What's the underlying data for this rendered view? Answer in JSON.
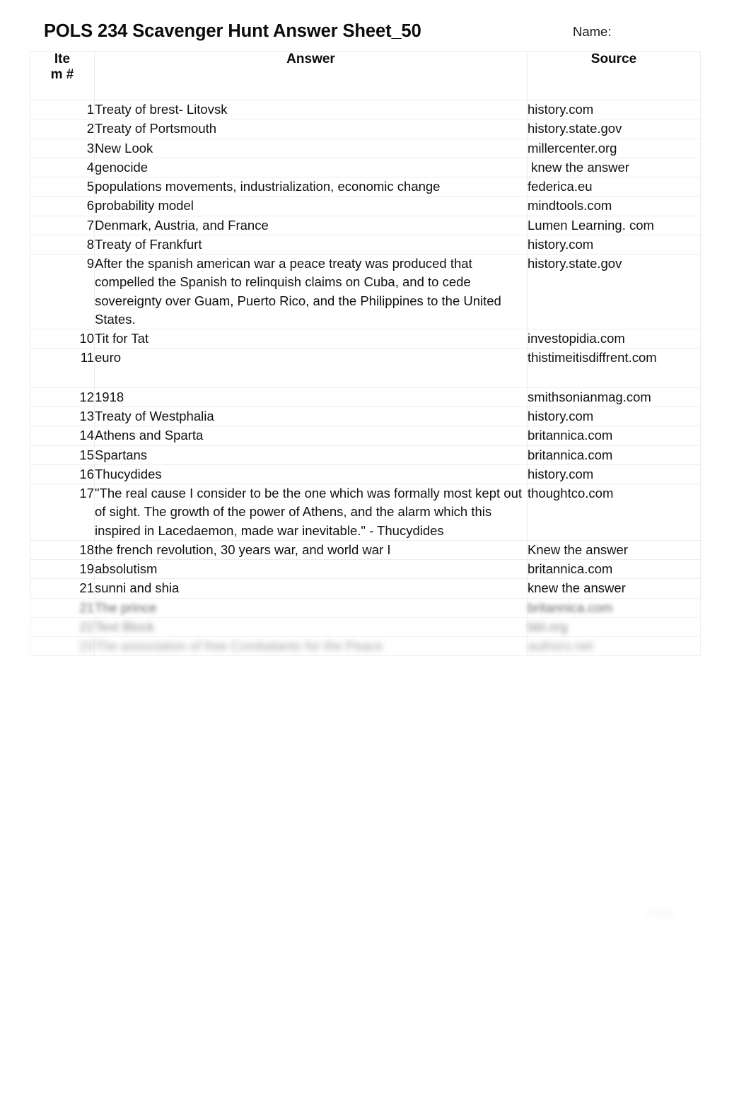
{
  "document": {
    "title": "POLS 234 Scavenger Hunt Answer Sheet_50",
    "name_label": "Name:",
    "page_number": "Page"
  },
  "table": {
    "columns": {
      "item": "Ite\nm #",
      "item_line1": "Ite",
      "item_line2": "m #",
      "answer": "Answer",
      "source": "Source"
    },
    "rows": [
      {
        "item": "1",
        "answer": "Treaty of brest- Litovsk",
        "source": "history.com"
      },
      {
        "item": "2",
        "answer": "Treaty of Portsmouth",
        "source": "history.state.gov"
      },
      {
        "item": "3",
        "answer": "New Look",
        "source": "millercenter.org"
      },
      {
        "item": "4",
        "answer": "genocide",
        "source": " knew the answer"
      },
      {
        "item": "5",
        "answer": "populations movements, industrialization, economic change",
        "source": "federica.eu"
      },
      {
        "item": "6",
        "answer": "probability model",
        "source": "mindtools.com"
      },
      {
        "item": "7",
        "answer": "Denmark, Austria, and France",
        "source": "Lumen Learning. com"
      },
      {
        "item": "8",
        "answer": "Treaty of Frankfurt",
        "source": "history.com"
      },
      {
        "item": "9",
        "answer": "After the spanish american war a peace treaty was produced that compelled the Spanish to relinquish claims on Cuba, and to cede sovereignty over Guam, Puerto Rico, and the Philippines to the United States.",
        "source": "history.state.gov"
      },
      {
        "item": "10",
        "answer": "Tit for Tat",
        "source": "investopidia.com"
      },
      {
        "item": "11",
        "answer": "euro",
        "source": "thistimeitisdiffrent.com"
      },
      {
        "item": "12",
        "answer": "1918",
        "source": "smithsonianmag.com"
      },
      {
        "item": "13",
        "answer": "Treaty of Westphalia",
        "source": "history.com"
      },
      {
        "item": "14",
        "answer": "Athens and Sparta",
        "source": "britannica.com"
      },
      {
        "item": "15",
        "answer": "Spartans",
        "source": "britannica.com"
      },
      {
        "item": "16",
        "answer": "Thucydides",
        "source": "history.com"
      },
      {
        "item": "17",
        "answer": "\"The real cause I consider to be the one which was formally most kept out of sight. The growth of the power of Athens, and the alarm which this inspired in Lacedaemon, made war inevitable.\" - Thucydides",
        "source": "thoughtco.com"
      },
      {
        "item": "18",
        "answer": "the french revolution, 30 years war, and world war I",
        "source": "Knew the answer"
      },
      {
        "item": "19",
        "answer": "absolutism",
        "source": "britannica.com"
      },
      {
        "item": "21",
        "answer": "sunni and shia",
        "source": "knew the answer"
      },
      {
        "item": "21",
        "answer": "The prince",
        "source": "britannica.com"
      },
      {
        "item": "22",
        "answer": "Text Block",
        "source": "bbl.org"
      },
      {
        "item": "23",
        "answer": "The association of free Combatants for the Peace",
        "source": "authors.net"
      }
    ]
  }
}
